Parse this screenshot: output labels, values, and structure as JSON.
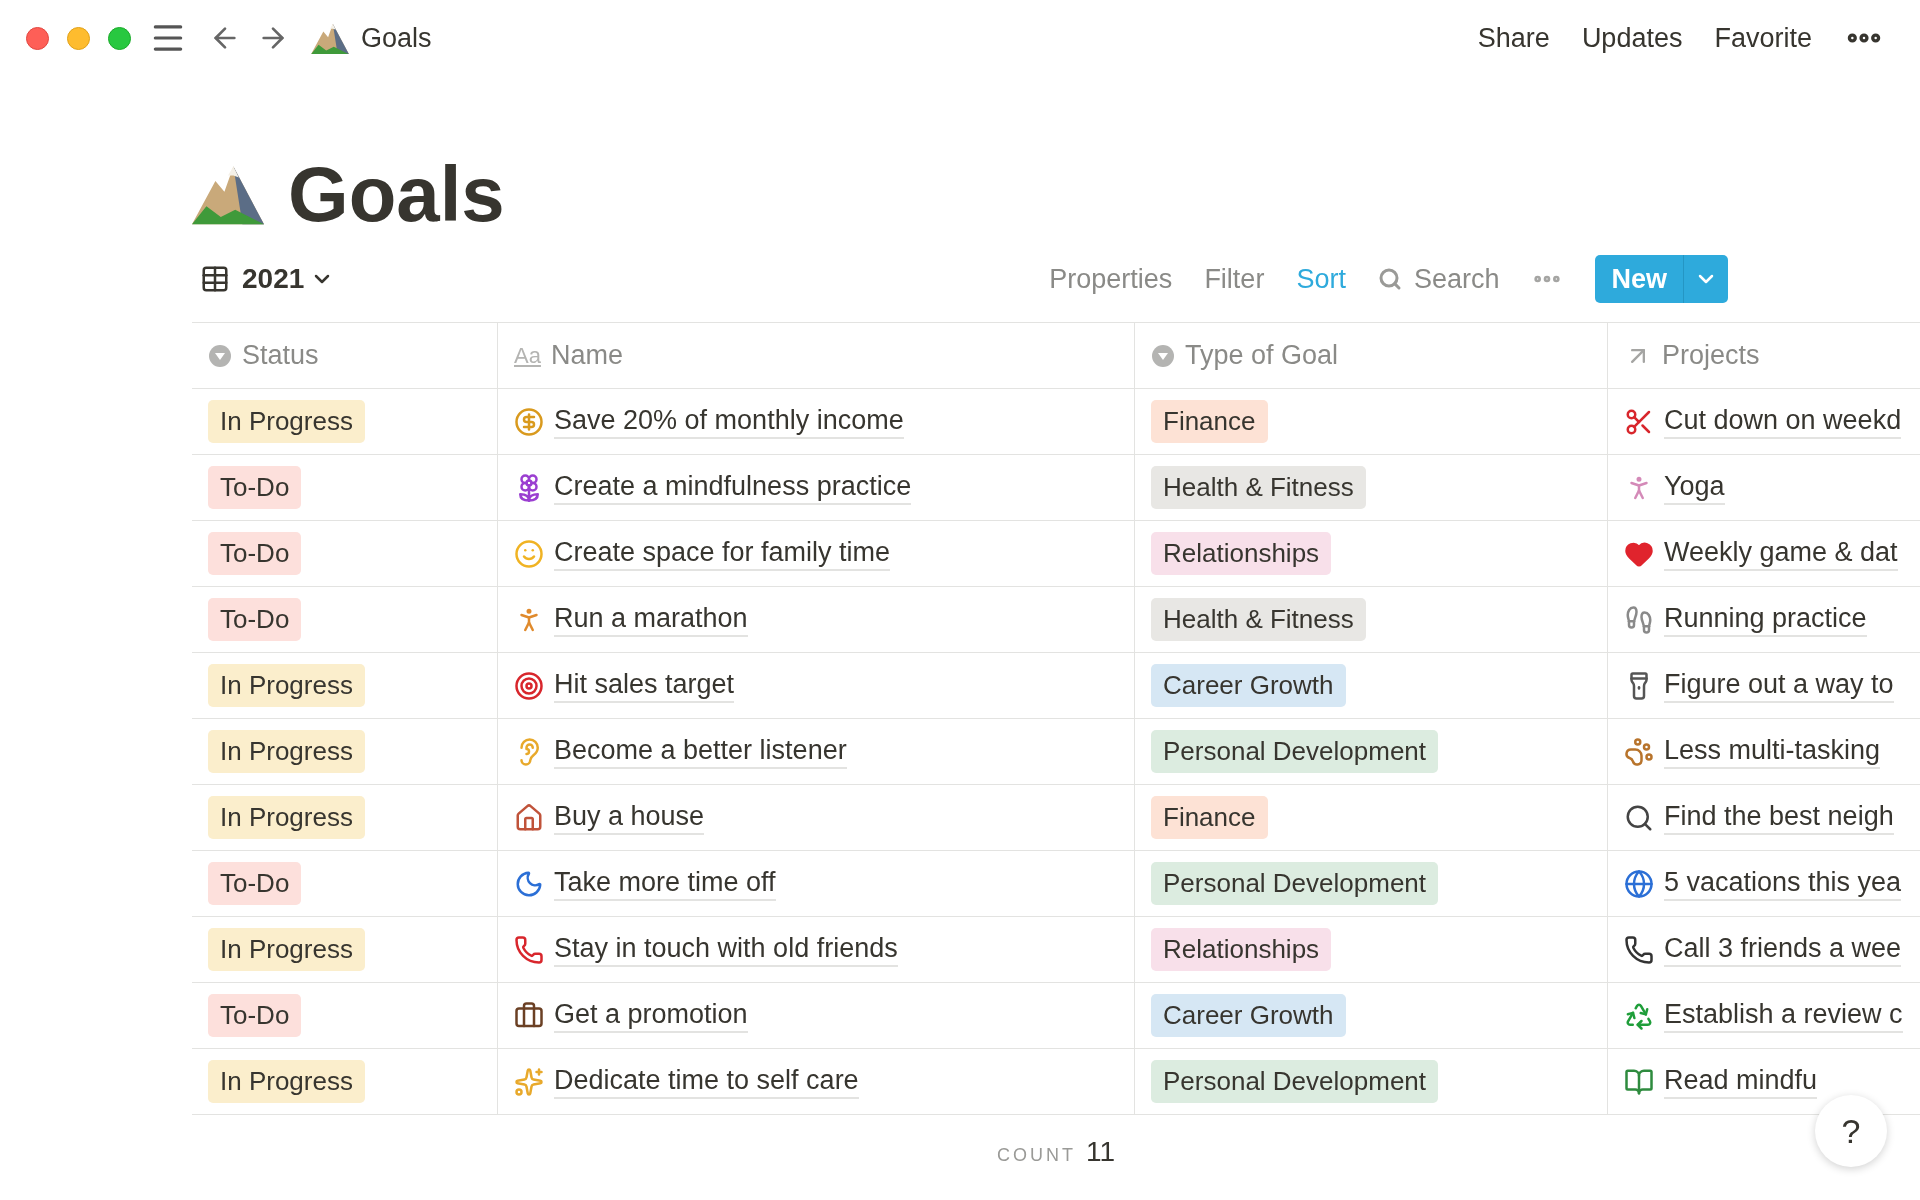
{
  "topbar": {
    "breadcrumb": "Goals",
    "actions": [
      "Share",
      "Updates",
      "Favorite"
    ]
  },
  "page": {
    "title": "Goals"
  },
  "view": {
    "name": "2021",
    "tools": [
      {
        "label": "Properties",
        "active": false
      },
      {
        "label": "Filter",
        "active": false
      },
      {
        "label": "Sort",
        "active": true
      }
    ],
    "search": "Search",
    "new_button": "New"
  },
  "table": {
    "columns": [
      {
        "label": "Status",
        "kind": "select"
      },
      {
        "label": "Name",
        "kind": "title",
        "glyph": "Aa"
      },
      {
        "label": "Type of Goal",
        "kind": "select"
      },
      {
        "label": "Projects",
        "kind": "relation"
      }
    ],
    "rows": [
      {
        "status": {
          "text": "In Progress",
          "color": "#fbeecc"
        },
        "name": "Save 20% of monthly income",
        "type": {
          "text": "Finance",
          "color": "#fde2d5"
        },
        "project": "Cut down on weekd"
      },
      {
        "status": {
          "text": "To-Do",
          "color": "#fde0dc"
        },
        "name": "Create a mindfulness practice",
        "type": {
          "text": "Health & Fitness",
          "color": "#e8e7e4"
        },
        "project": "Yoga"
      },
      {
        "status": {
          "text": "To-Do",
          "color": "#fde0dc"
        },
        "name": "Create space for family time",
        "type": {
          "text": "Relationships",
          "color": "#f8e0ea"
        },
        "project": "Weekly game & dat"
      },
      {
        "status": {
          "text": "To-Do",
          "color": "#fde0dc"
        },
        "name": "Run a marathon",
        "type": {
          "text": "Health & Fitness",
          "color": "#e8e7e4"
        },
        "project": "Running practice"
      },
      {
        "status": {
          "text": "In Progress",
          "color": "#fbeecc"
        },
        "name": "Hit sales target",
        "type": {
          "text": "Career Growth",
          "color": "#d6e7f4"
        },
        "project": "Figure out a way to"
      },
      {
        "status": {
          "text": "In Progress",
          "color": "#fbeecc"
        },
        "name": "Become a better listener",
        "type": {
          "text": "Personal Development",
          "color": "#dcece0"
        },
        "project": "Less multi-tasking"
      },
      {
        "status": {
          "text": "In Progress",
          "color": "#fbeecc"
        },
        "name": "Buy a house",
        "type": {
          "text": "Finance",
          "color": "#fde2d5"
        },
        "project": "Find the best neigh"
      },
      {
        "status": {
          "text": "To-Do",
          "color": "#fde0dc"
        },
        "name": "Take more time off",
        "type": {
          "text": "Personal Development",
          "color": "#dcece0"
        },
        "project": "5 vacations this yea"
      },
      {
        "status": {
          "text": "In Progress",
          "color": "#fbeecc"
        },
        "name": "Stay in touch with old friends",
        "type": {
          "text": "Relationships",
          "color": "#f8e0ea"
        },
        "project": "Call 3 friends a wee"
      },
      {
        "status": {
          "text": "To-Do",
          "color": "#fde0dc"
        },
        "name": "Get a promotion",
        "type": {
          "text": "Career Growth",
          "color": "#d6e7f4"
        },
        "project": "Establish a review c"
      },
      {
        "status": {
          "text": "In Progress",
          "color": "#fbeecc"
        },
        "name": "Dedicate time to self care",
        "type": {
          "text": "Personal Development",
          "color": "#dcece0"
        },
        "project": "Read mindfu"
      }
    ]
  },
  "footer": {
    "label": "COUNT",
    "value": "11"
  },
  "help_button": "?"
}
